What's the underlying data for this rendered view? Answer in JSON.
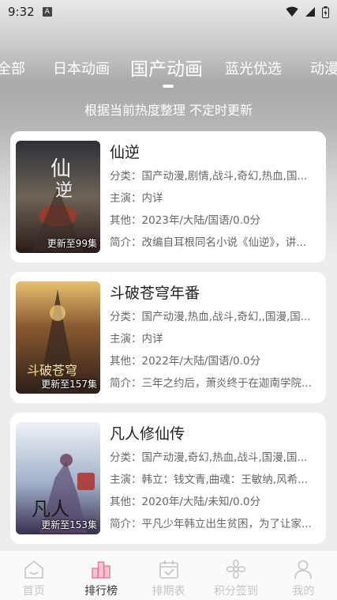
{
  "status_bar": {
    "time": "9:32",
    "notification_badge": "A"
  },
  "tabs": [
    {
      "label": "全部",
      "active": false
    },
    {
      "label": "日本动画",
      "active": false
    },
    {
      "label": "国产动画",
      "active": true
    },
    {
      "label": "蓝光优选",
      "active": false
    },
    {
      "label": "动漫",
      "active": false
    }
  ],
  "subtitle": "根据当前热度整理 不定时更新",
  "items": [
    {
      "title": "仙逆",
      "category": "分类：国产动漫,剧情,战斗,奇幻,热血,国...",
      "cast": "主演：内详",
      "other": "其他：2023年/大陆/国语/0.0分",
      "summary": "简介：改编自耳根同名小说《仙逆》，讲...",
      "badge": "更新至99集",
      "poster_text": "仙逆",
      "colors": [
        "#3a3a44",
        "#7a6a5a",
        "#a13a2a"
      ]
    },
    {
      "title": "斗破苍穹年番",
      "category": "分类：国产动漫,热血,战斗,奇幻,,国漫,国...",
      "cast": "主演：内详",
      "other": "其他：2022年/大陆/国语/0.0分",
      "summary": "简介：三年之约后，萧炎终于在迦南学院...",
      "badge": "更新至157集",
      "poster_text": "斗破苍穹",
      "colors": [
        "#3b2a22",
        "#a0622e",
        "#e0b060"
      ]
    },
    {
      "title": "凡人修仙传",
      "category": "分类：国产动漫,奇幻,热血,战斗,国漫,国...",
      "cast": "主演：韩立：钱文青,曲魂：王敏纳,风希...",
      "other": "其他：2020年/大陆/未知/0.0分",
      "summary": "简介：平凡少年韩立出生贫困，为了让家...",
      "badge": "更新至153集",
      "poster_text": "凡人",
      "colors": [
        "#dfe6ef",
        "#8fa3c0",
        "#6a4a6a"
      ]
    }
  ],
  "nav": [
    {
      "label": "首页",
      "icon": "home-icon",
      "active": false
    },
    {
      "label": "排行榜",
      "icon": "ranking-icon",
      "active": true
    },
    {
      "label": "排期表",
      "icon": "calendar-icon",
      "active": false
    },
    {
      "label": "积分签到",
      "icon": "checkin-icon",
      "active": false
    },
    {
      "label": "我的",
      "icon": "profile-icon",
      "active": false
    }
  ]
}
